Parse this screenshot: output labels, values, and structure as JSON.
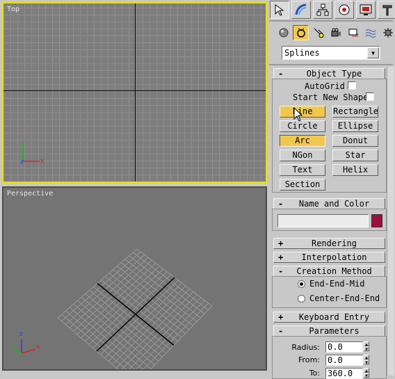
{
  "viewports": {
    "top": {
      "label": "Top",
      "active": true
    },
    "perspective": {
      "label": "Perspective"
    }
  },
  "tripod": {
    "x": "x",
    "y": "y",
    "z": "z"
  },
  "command_panel": {
    "tabs": [
      {
        "icon": "create-icon",
        "active": true
      },
      {
        "icon": "modify-icon"
      },
      {
        "icon": "hierarchy-icon"
      },
      {
        "icon": "motion-icon"
      },
      {
        "icon": "display-icon"
      },
      {
        "icon": "utilities-icon"
      }
    ],
    "categories": [
      {
        "icon": "geometry-icon"
      },
      {
        "icon": "shapes-icon",
        "active": true
      },
      {
        "icon": "lights-icon"
      },
      {
        "icon": "cameras-icon"
      },
      {
        "icon": "helpers-icon"
      },
      {
        "icon": "space-warps-icon"
      },
      {
        "icon": "systems-icon"
      }
    ],
    "category_dropdown": "Splines",
    "object_type": {
      "title": "Object Type",
      "sign": "-",
      "autogrid_label": "AutoGrid",
      "start_new_shape_label": "Start New Shape",
      "buttons": [
        "Line",
        "Rectangle",
        "Circle",
        "Ellipse",
        "Arc",
        "Donut",
        "NGon",
        "Star",
        "Text",
        "Helix",
        "Section"
      ]
    },
    "name_and_color": {
      "title": "Name and Color",
      "sign": "-",
      "name_value": "",
      "swatch_color": "#9a1040"
    },
    "rendering": {
      "title": "Rendering",
      "sign": "+"
    },
    "interpolation": {
      "title": "Interpolation",
      "sign": "+"
    },
    "creation_method": {
      "title": "Creation Method",
      "sign": "-",
      "options": [
        "End-End-Mid",
        "Center-End-End"
      ],
      "selected": 0
    },
    "keyboard_entry": {
      "title": "Keyboard Entry",
      "sign": "+"
    },
    "parameters": {
      "title": "Parameters",
      "sign": "-",
      "radius_label": "Radius:",
      "radius_value": "0.0",
      "from_label": "From:",
      "from_value": "0.0",
      "to_label": "To:",
      "to_value": "360.0"
    }
  }
}
